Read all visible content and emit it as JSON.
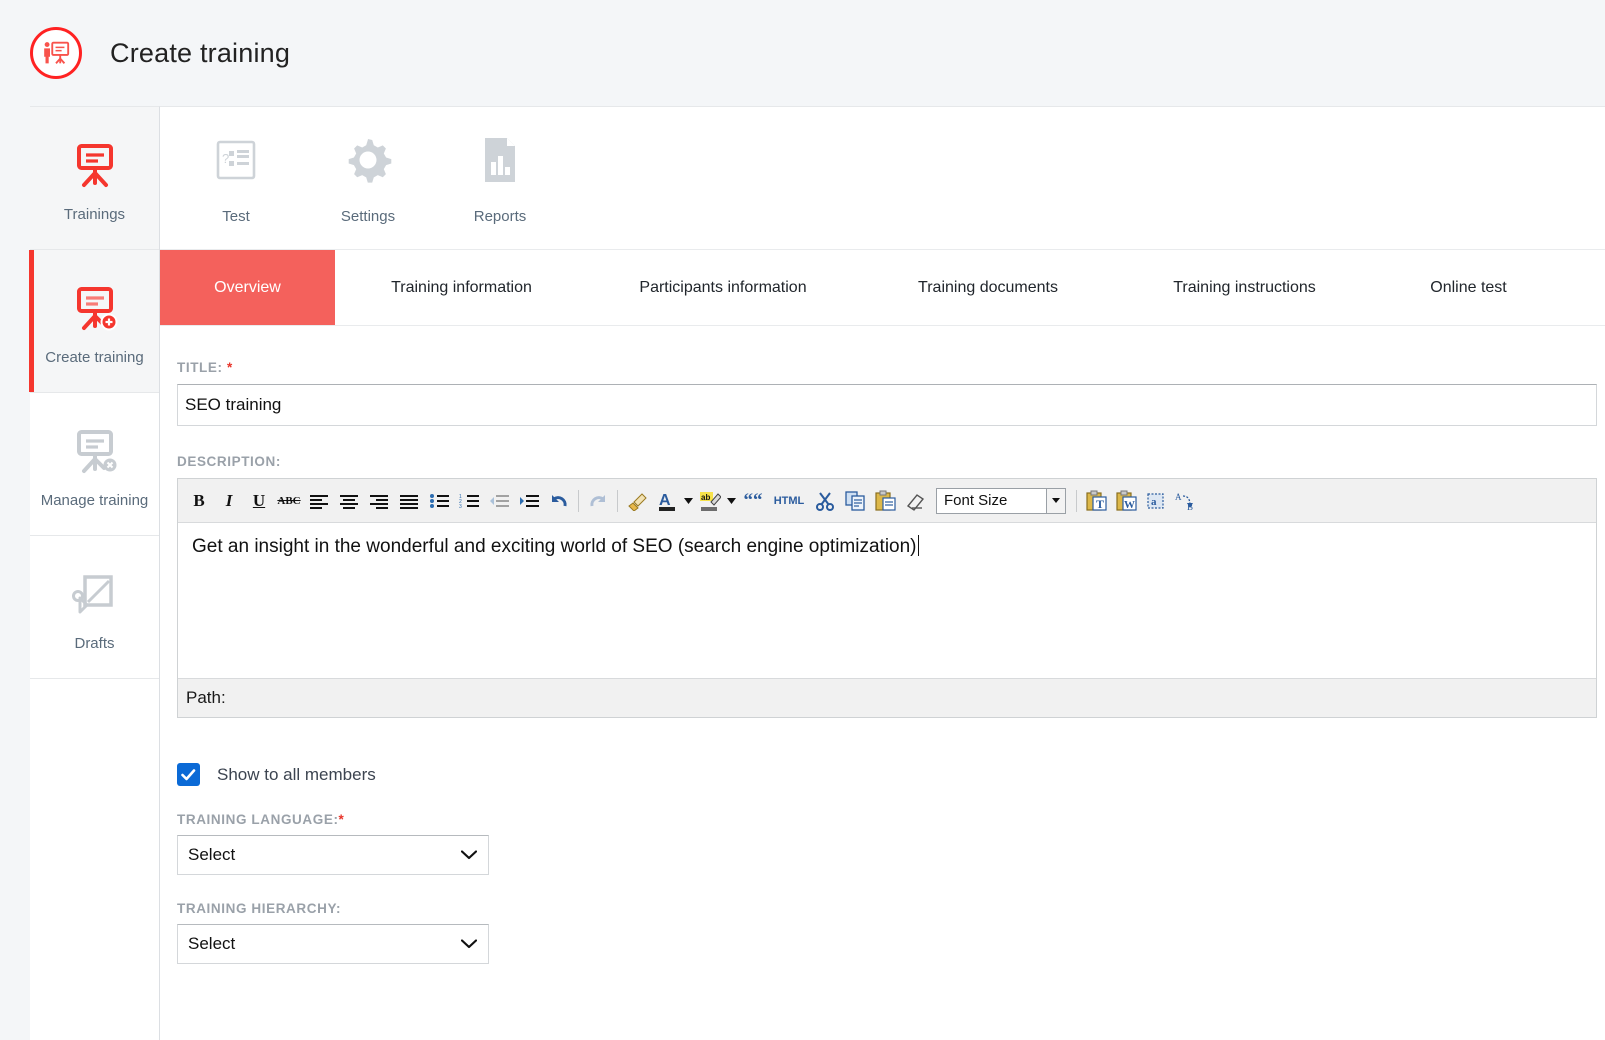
{
  "header": {
    "title": "Create training",
    "icon": "create-training-circle-icon"
  },
  "sidebar": {
    "items": [
      {
        "label": "Trainings",
        "icon": "easel-icon",
        "state": "shaded"
      },
      {
        "label": "Create training",
        "icon": "easel-plus-icon",
        "state": "active"
      },
      {
        "label": "Manage training",
        "icon": "easel-settings-icon",
        "state": "default"
      },
      {
        "label": "Drafts",
        "icon": "draft-pencil-icon",
        "state": "default"
      }
    ]
  },
  "topnav": {
    "items": [
      {
        "label": "Test",
        "icon": "quiz-list-icon"
      },
      {
        "label": "Settings",
        "icon": "gear-icon"
      },
      {
        "label": "Reports",
        "icon": "report-chart-icon"
      }
    ]
  },
  "tabs": [
    {
      "label": "Overview",
      "active": true
    },
    {
      "label": "Training information",
      "active": false
    },
    {
      "label": "Participants information",
      "active": false
    },
    {
      "label": "Training documents",
      "active": false
    },
    {
      "label": "Training instructions",
      "active": false
    },
    {
      "label": "Online test",
      "active": false
    }
  ],
  "form": {
    "title_label": "TITLE:",
    "title_required": "*",
    "title_value": "SEO training",
    "title_placeholder": "",
    "description_label": "DESCRIPTION:",
    "description_value": "Get an insight in the wonderful and exciting world of SEO (search engine optimization)",
    "editor_path_label": "Path:",
    "checkbox_label": "Show to all members",
    "checkbox_checked": true,
    "language_label": "TRAINING LANGUAGE:",
    "language_required": "*",
    "language_value": "Select",
    "hierarchy_label": "TRAINING HIERARCHY:",
    "hierarchy_value": "Select"
  },
  "editor_toolbar": {
    "font_size_label": "Font Size",
    "buttons": [
      {
        "name": "bold-icon",
        "label": "B"
      },
      {
        "name": "italic-icon",
        "label": "I"
      },
      {
        "name": "underline-icon",
        "label": "U"
      },
      {
        "name": "strikethrough-icon",
        "label": "ABC"
      },
      {
        "name": "align-left-icon",
        "label": ""
      },
      {
        "name": "align-center-icon",
        "label": ""
      },
      {
        "name": "align-right-icon",
        "label": ""
      },
      {
        "name": "align-justify-icon",
        "label": ""
      },
      {
        "name": "bullet-list-icon",
        "label": ""
      },
      {
        "name": "numbered-list-icon",
        "label": ""
      },
      {
        "name": "outdent-icon",
        "label": ""
      },
      {
        "name": "indent-icon",
        "label": ""
      },
      {
        "name": "undo-icon",
        "label": ""
      },
      {
        "name": "redo-icon",
        "label": ""
      },
      {
        "name": "format-painter-icon",
        "label": ""
      },
      {
        "name": "text-color-icon",
        "label": "A"
      },
      {
        "name": "highlight-color-icon",
        "label": "ab"
      },
      {
        "name": "blockquote-icon",
        "label": "““"
      },
      {
        "name": "html-source-icon",
        "label": "HTML"
      },
      {
        "name": "cut-icon",
        "label": ""
      },
      {
        "name": "copy-icon",
        "label": ""
      },
      {
        "name": "paste-icon",
        "label": ""
      },
      {
        "name": "eraser-icon",
        "label": ""
      },
      {
        "name": "paste-as-text-icon",
        "label": "T"
      },
      {
        "name": "paste-from-word-icon",
        "label": "W"
      },
      {
        "name": "find-icon",
        "label": "a"
      },
      {
        "name": "replace-icon",
        "label": ""
      }
    ]
  },
  "colors": {
    "accent_red": "#f5362e",
    "tab_active": "#f4615c",
    "icon_gray": "#c7ccd1",
    "label_gray": "#9aa1a9",
    "checkbox_blue": "#0b6ad6",
    "page_bg": "#f4f6f8"
  }
}
